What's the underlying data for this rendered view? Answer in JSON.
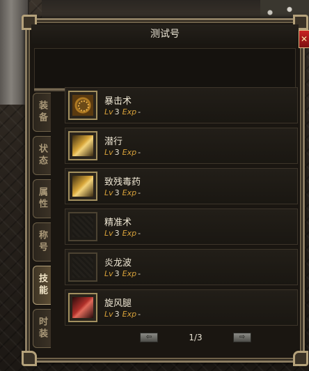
{
  "window": {
    "title": "测试号",
    "close_label": "✕"
  },
  "tabs": [
    {
      "label": "装备",
      "active": false
    },
    {
      "label": "状态",
      "active": false
    },
    {
      "label": "属性",
      "active": false
    },
    {
      "label": "称号",
      "active": false
    },
    {
      "label": "技能",
      "active": true
    },
    {
      "label": "时装",
      "active": false
    }
  ],
  "skills": [
    {
      "name": "暴击术",
      "lv_label": "Lv",
      "level": "3",
      "exp_label": "Exp",
      "exp": "-",
      "icon": "ring-rune-icon"
    },
    {
      "name": "潜行",
      "lv_label": "Lv",
      "level": "3",
      "exp_label": "Exp",
      "exp": "-",
      "icon": "gold-claw-icon"
    },
    {
      "name": "致残毒药",
      "lv_label": "Lv",
      "level": "3",
      "exp_label": "Exp",
      "exp": "-",
      "icon": "gold-claw-icon"
    },
    {
      "name": "精准术",
      "lv_label": "Lv",
      "level": "3",
      "exp_label": "Exp",
      "exp": "-",
      "icon": "empty-slot-icon"
    },
    {
      "name": "炎龙波",
      "lv_label": "Lv",
      "level": "3",
      "exp_label": "Exp",
      "exp": "-",
      "icon": "empty-slot-icon"
    },
    {
      "name": "旋风腿",
      "lv_label": "Lv",
      "level": "3",
      "exp_label": "Exp",
      "exp": "-",
      "icon": "red-claw-icon"
    }
  ],
  "pager": {
    "text": "1/3",
    "prev_symbol": "⇦",
    "next_symbol": "⇨"
  }
}
